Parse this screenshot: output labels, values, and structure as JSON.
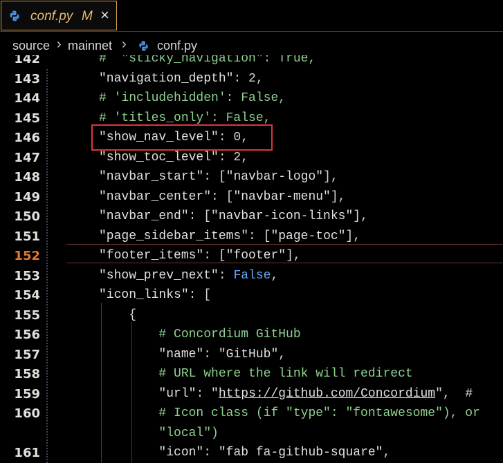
{
  "tab": {
    "filename": "conf.py",
    "modified": "M",
    "close": "×",
    "icon": "python-icon"
  },
  "breadcrumb": {
    "items": [
      "source",
      "mainnet",
      "conf.py"
    ],
    "separator": "›"
  },
  "editor": {
    "current_line": "152",
    "lines": [
      {
        "num": "142",
        "html_segments": [
          {
            "t": "#  \"sticky_navigation\": True,",
            "c": "com"
          }
        ]
      },
      {
        "num": "143",
        "html_segments": [
          {
            "t": "\"navigation_depth\"",
            "c": "key"
          },
          {
            "t": ": 2,",
            "c": ""
          }
        ]
      },
      {
        "num": "144",
        "html_segments": [
          {
            "t": "# 'includehidden': False,",
            "c": "com"
          }
        ]
      },
      {
        "num": "145",
        "html_segments": [
          {
            "t": "# 'titles_only': False,",
            "c": "com"
          }
        ]
      },
      {
        "num": "146",
        "html_segments": [
          {
            "t": "\"show_nav_level\"",
            "c": "key"
          },
          {
            "t": ": 0,",
            "c": ""
          }
        ]
      },
      {
        "num": "147",
        "html_segments": [
          {
            "t": "\"show_toc_level\"",
            "c": "key"
          },
          {
            "t": ": 2,",
            "c": ""
          }
        ]
      },
      {
        "num": "148",
        "html_segments": [
          {
            "t": "\"navbar_start\"",
            "c": "key"
          },
          {
            "t": ": [",
            "c": ""
          },
          {
            "t": "\"navbar-logo\"",
            "c": "str"
          },
          {
            "t": "],",
            "c": ""
          }
        ]
      },
      {
        "num": "149",
        "html_segments": [
          {
            "t": "\"navbar_center\"",
            "c": "key"
          },
          {
            "t": ": [",
            "c": ""
          },
          {
            "t": "\"navbar-menu\"",
            "c": "str"
          },
          {
            "t": "],",
            "c": ""
          }
        ]
      },
      {
        "num": "150",
        "html_segments": [
          {
            "t": "\"navbar_end\"",
            "c": "key"
          },
          {
            "t": ": [",
            "c": ""
          },
          {
            "t": "\"navbar-icon-links\"",
            "c": "str"
          },
          {
            "t": "],",
            "c": ""
          }
        ]
      },
      {
        "num": "151",
        "html_segments": [
          {
            "t": "\"page_sidebar_items\"",
            "c": "key"
          },
          {
            "t": ": [",
            "c": ""
          },
          {
            "t": "\"page-toc\"",
            "c": "str"
          },
          {
            "t": "],",
            "c": ""
          }
        ]
      },
      {
        "num": "152",
        "html_segments": [
          {
            "t": "\"footer_items\"",
            "c": "key"
          },
          {
            "t": ": [",
            "c": ""
          },
          {
            "t": "\"footer\"",
            "c": "str"
          },
          {
            "t": "],",
            "c": ""
          }
        ]
      },
      {
        "num": "153",
        "html_segments": [
          {
            "t": "\"show_prev_next\"",
            "c": "key"
          },
          {
            "t": ": ",
            "c": ""
          },
          {
            "t": "False",
            "c": "kw"
          },
          {
            "t": ",",
            "c": ""
          }
        ]
      },
      {
        "num": "154",
        "html_segments": [
          {
            "t": "\"icon_links\"",
            "c": "key"
          },
          {
            "t": ": [",
            "c": ""
          }
        ]
      },
      {
        "num": "155",
        "html_segments": [
          {
            "t": "    {",
            "c": ""
          }
        ]
      },
      {
        "num": "156",
        "html_segments": [
          {
            "t": "        # Concordium GitHub",
            "c": "com"
          }
        ]
      },
      {
        "num": "157",
        "html_segments": [
          {
            "t": "        \"name\"",
            "c": "key"
          },
          {
            "t": ": ",
            "c": ""
          },
          {
            "t": "\"GitHub\"",
            "c": "str"
          },
          {
            "t": ",",
            "c": ""
          }
        ]
      },
      {
        "num": "158",
        "html_segments": [
          {
            "t": "        # URL where the link will redirect",
            "c": "com"
          }
        ]
      },
      {
        "num": "159",
        "html_segments": [
          {
            "t": "        \"url\"",
            "c": "key"
          },
          {
            "t": ": ",
            "c": ""
          },
          {
            "t": "\"",
            "c": "str"
          },
          {
            "t": "https://github.com/Concordium",
            "c": "url"
          },
          {
            "t": "\",  # ",
            "c": ""
          }
        ]
      },
      {
        "num": "160",
        "html_segments": [
          {
            "t": "        # Icon class (if \"type\": \"fontawesome\"), or",
            "c": "com"
          }
        ]
      },
      {
        "num": "",
        "html_segments": [
          {
            "t": "        \"local\")",
            "c": "com"
          }
        ]
      },
      {
        "num": "161",
        "html_segments": [
          {
            "t": "        \"icon\"",
            "c": "key"
          },
          {
            "t": ": ",
            "c": ""
          },
          {
            "t": "\"fab fa-github-square\"",
            "c": "str"
          },
          {
            "t": ",",
            "c": ""
          }
        ]
      }
    ]
  }
}
